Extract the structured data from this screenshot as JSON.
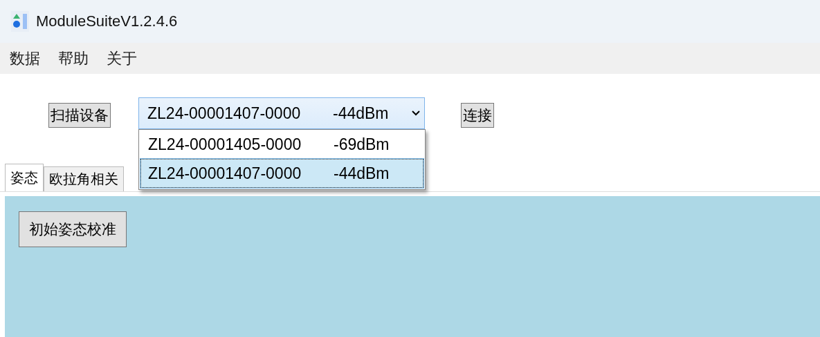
{
  "window": {
    "title": "ModuleSuiteV1.2.4.6"
  },
  "menu": [
    "数据",
    "帮助",
    "关于"
  ],
  "toolbar": {
    "scan_button": "扫描设备",
    "device_select": {
      "name": "ZL24-00001407-0000",
      "rssi": "-44dBm",
      "expanded": true,
      "options": [
        {
          "name": "ZL24-00001405-0000",
          "rssi": "-69dBm",
          "selected": false
        },
        {
          "name": "ZL24-00001407-0000",
          "rssi": "-44dBm",
          "selected": true
        }
      ]
    },
    "connect_button": "连接"
  },
  "tabs": [
    {
      "label": "姿态",
      "selected": true
    },
    {
      "label": "欧拉角相关",
      "selected": false
    }
  ],
  "panel": {
    "buttons": [
      "初始姿态校准"
    ]
  }
}
